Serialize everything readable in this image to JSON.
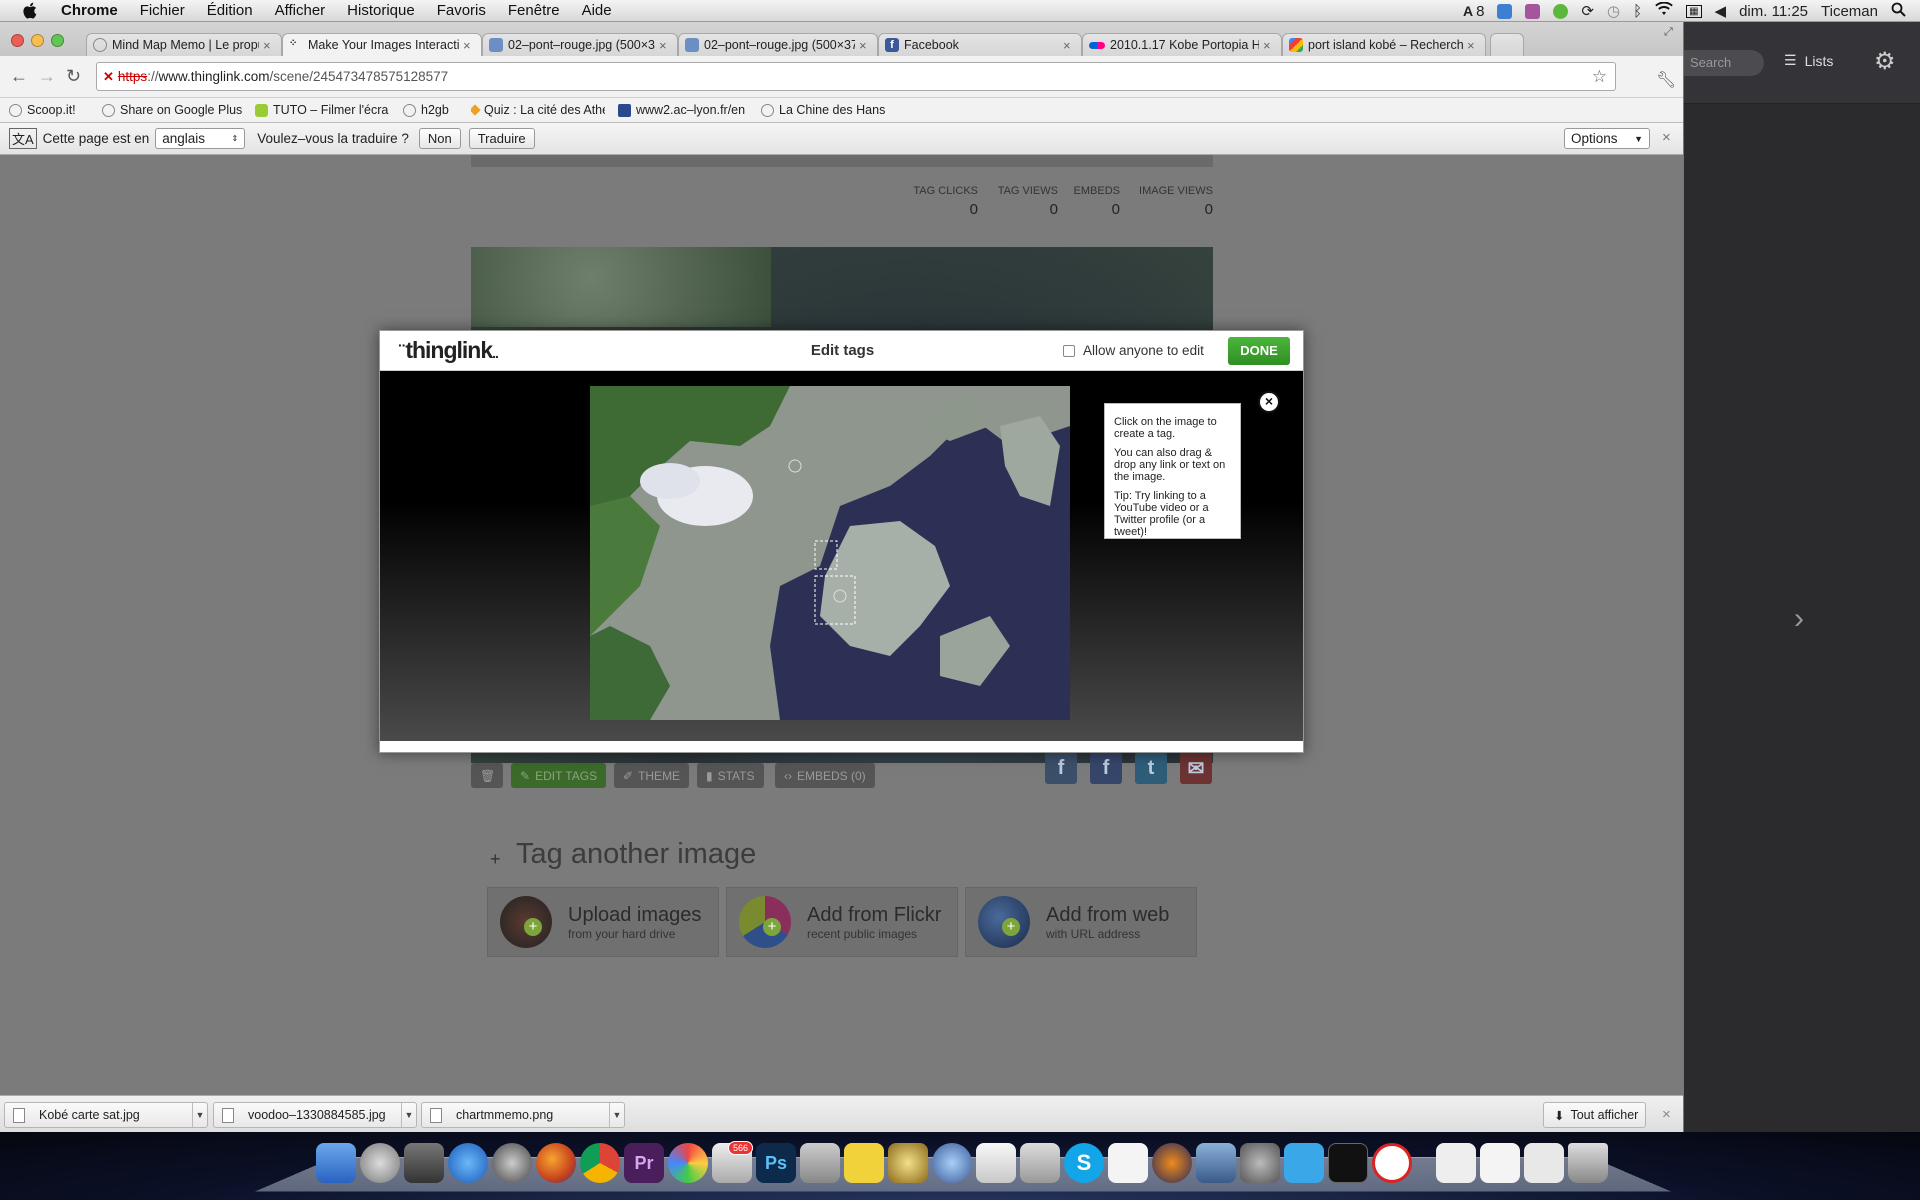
{
  "menubar": {
    "app": "Chrome",
    "items": [
      "Fichier",
      "Édition",
      "Afficher",
      "Historique",
      "Favoris",
      "Fenêtre",
      "Aide"
    ],
    "status_count": "8",
    "clock": "dim. 11:25",
    "user": "Ticeman"
  },
  "tabs": [
    {
      "title": "Mind Map Memo | Le propuls"
    },
    {
      "title": "Make Your Images Interactiv",
      "active": true
    },
    {
      "title": "02–pont–rouge.jpg (500×37"
    },
    {
      "title": "02–pont–rouge.jpg (500×37"
    },
    {
      "title": "Facebook"
    },
    {
      "title": "2010.1.17 Kobe Portopia Ho"
    },
    {
      "title": "port island kobé – Recherche"
    }
  ],
  "omnibox": {
    "scheme": "https",
    "sep": "://",
    "host": "www.thinglink.com",
    "path": "/scene/245473478575128577"
  },
  "bookmarks": [
    "Scoop.it!",
    "Share on Google Plus",
    "TUTO – Filmer l'écra",
    "h2gb",
    "Quiz : La cité des Athé",
    "www2.ac–lyon.fr/en",
    "La Chine des Hans"
  ],
  "translate": {
    "prefix": "Cette page est en",
    "language": "anglais",
    "question": "Voulez–vous la traduire ?",
    "no": "Non",
    "translate": "Traduire",
    "options": "Options"
  },
  "stats": {
    "tag_clicks_label": "TAG CLICKS",
    "tag_clicks": "0",
    "tag_views_label": "TAG VIEWS",
    "tag_views": "0",
    "embeds_label": "EMBEDS",
    "embeds": "0",
    "image_views_label": "IMAGE VIEWS",
    "image_views": "0"
  },
  "image_toolbar": {
    "edit_tags": "EDIT TAGS",
    "theme": "THEME",
    "stats": "STATS",
    "embeds": "EMBEDS (0)"
  },
  "tag_another": {
    "plus": "+",
    "title": "Tag another image",
    "upload_title": "Upload images",
    "upload_sub": "from your hard drive",
    "flickr_title": "Add from Flickr",
    "flickr_sub": "recent public images",
    "web_title": "Add from web",
    "web_sub": "with URL address"
  },
  "modal": {
    "logo": "thinglink",
    "title": "Edit tags",
    "allow": "Allow anyone to edit",
    "done": "DONE",
    "tip1": "Click on the image to create a tag.",
    "tip2": "You can also drag & drop any link or text on the image.",
    "tip3": "Tip: Try linking to a YouTube video or a Twitter profile (or a tweet)!"
  },
  "downloads": {
    "items": [
      "Kobé carte sat.jpg",
      "voodoo–1330884585.jpg",
      "chartmmemo.png"
    ],
    "show_all": "Tout afficher"
  },
  "rightapp": {
    "search": "Search",
    "lists": "Lists"
  },
  "dock": {
    "mail_badge": "566"
  }
}
